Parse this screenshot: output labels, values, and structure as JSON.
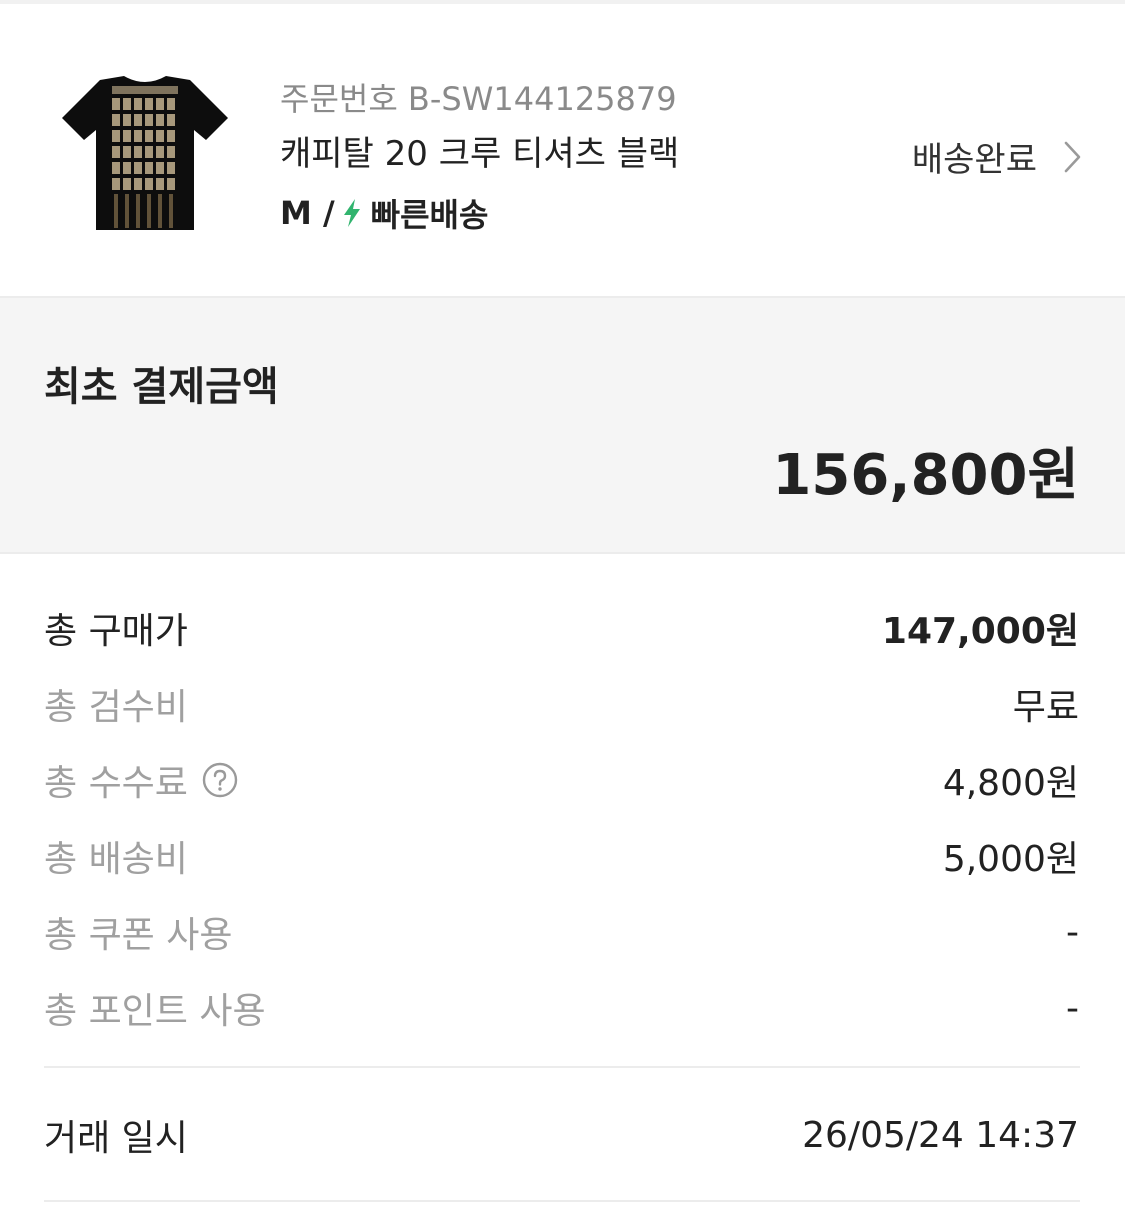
{
  "product": {
    "order_number": "주문번호 B-SW144125879",
    "name": "캐피탈 20 크루 티셔츠 블랙",
    "size": "M /",
    "delivery_type": "빠른배송",
    "status": "배송완료",
    "accent_color": "#31b46e",
    "thumbnail_icon": "tshirt-image",
    "status_icon": "chevron-right-icon",
    "delivery_icon": "lightning-bolt-icon"
  },
  "payment": {
    "title": "최초 결제금액",
    "amount": "156,800원"
  },
  "breakdown": [
    {
      "label": "총 구매가",
      "value": "147,000원"
    },
    {
      "label": "총 검수비",
      "value": "무료"
    },
    {
      "label": "총 수수료",
      "value": "4,800원"
    },
    {
      "label": "총 배송비",
      "value": "5,000원"
    },
    {
      "label": "총 쿠폰 사용",
      "value": "-"
    },
    {
      "label": "총 포인트 사용",
      "value": "-"
    }
  ],
  "trade": {
    "label": "거래 일시",
    "value": "26/05/24 14:37"
  }
}
